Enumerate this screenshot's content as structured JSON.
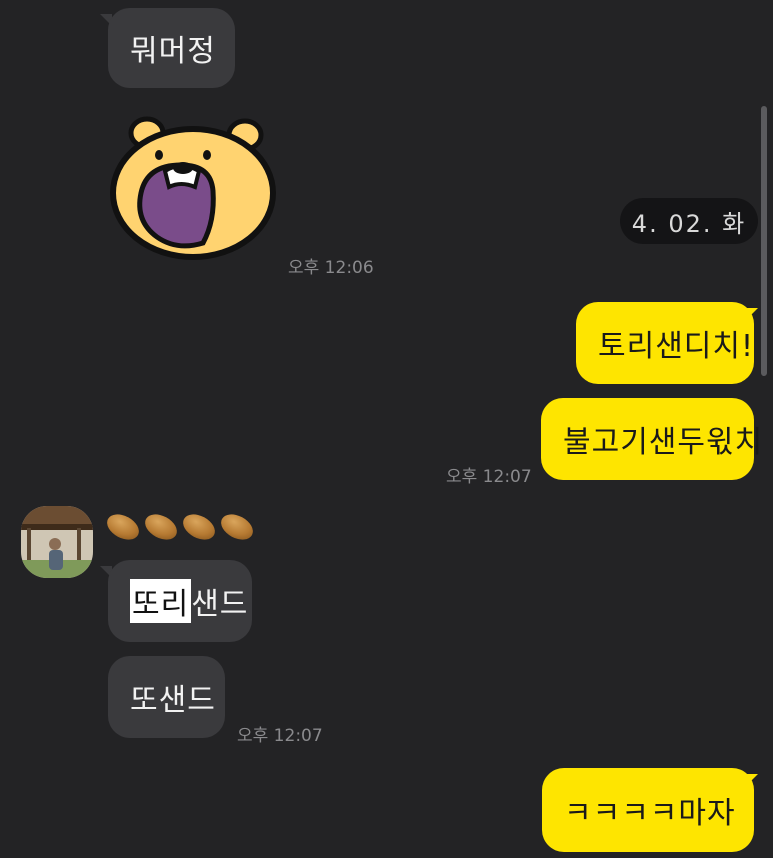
{
  "messages": {
    "m1": {
      "text": "뭐머정"
    },
    "ts1": "오후 12:06",
    "date_divider": "4. 02. 화",
    "m2": {
      "text": "토리샌디치!"
    },
    "m3": {
      "text": "불고기샌두윇치"
    },
    "ts2": "오후 12:07",
    "m4": {
      "text_highlight": "또리",
      "text_rest": "샌드"
    },
    "m5": {
      "text": "또샌드"
    },
    "ts3": "오후 12:07",
    "m6": {
      "text": "ㅋㅋㅋㅋ마자"
    }
  },
  "colors": {
    "background": "#232325",
    "incoming_bubble": "#3a3a3d",
    "outgoing_bubble": "#fee500",
    "timestamp": "#8a8a8d"
  },
  "icons": {
    "sticker": "yellow-bear-sticker",
    "emoji_row": "potato-emoji",
    "avatar": "profile-photo"
  }
}
